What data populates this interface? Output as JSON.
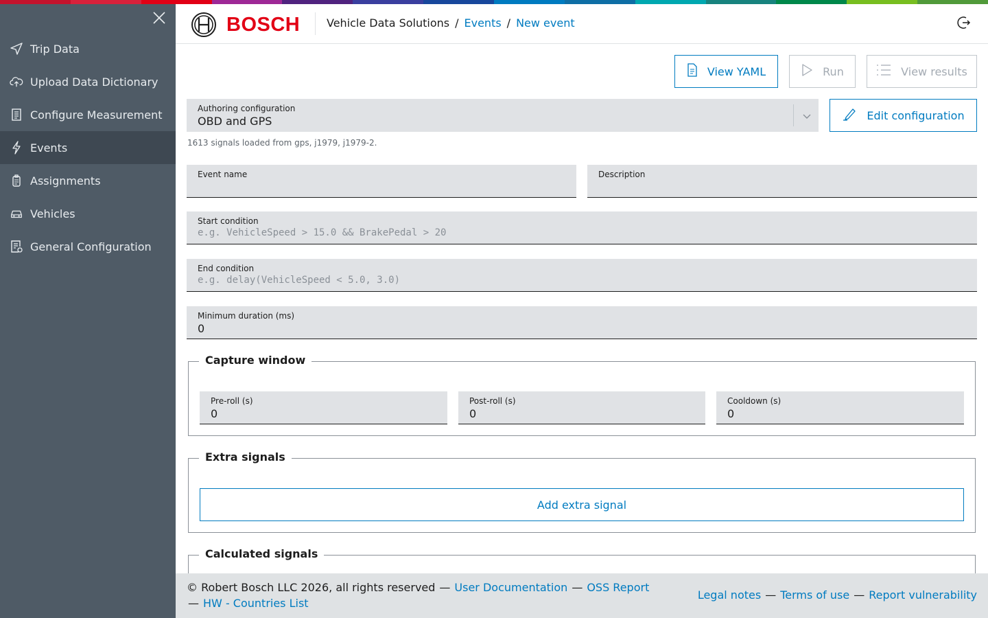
{
  "colors": {
    "brand_red": "#e20015",
    "accent_blue": "#007bc0",
    "sidebar_bg": "#4f5b66",
    "sidebar_active": "#3e4852",
    "topbar_stripes": [
      "#c3122c",
      "#d8213b",
      "#e20015",
      "#9e2896",
      "#50237f",
      "#3a3f9f",
      "#18479c",
      "#007bc0",
      "#0e6ea5",
      "#00a8b0",
      "#18837e",
      "#00884a",
      "#78be20",
      "#519a3a"
    ]
  },
  "sidebar": {
    "close_icon": "close-icon",
    "items": [
      {
        "label": "Trip Data",
        "icon": "send-icon"
      },
      {
        "label": "Upload Data Dictionary",
        "icon": "cloud-upload-icon"
      },
      {
        "label": "Configure Measurement",
        "icon": "document-list-icon"
      },
      {
        "label": "Events",
        "icon": "lightning-icon",
        "active": true
      },
      {
        "label": "Assignments",
        "icon": "assignment-icon"
      },
      {
        "label": "Vehicles",
        "icon": "car-icon"
      },
      {
        "label": "General Configuration",
        "icon": "config-document-icon"
      }
    ]
  },
  "header": {
    "brand": "BOSCH",
    "app_name": "Vehicle Data Solutions",
    "breadcrumb_sep": "/",
    "breadcrumbs": [
      "Events",
      "New event"
    ],
    "logout_icon": "logout-icon"
  },
  "toolbar": {
    "view_yaml": "View YAML",
    "run": "Run",
    "view_results": "View results"
  },
  "authoring": {
    "label": "Authoring configuration",
    "value": "OBD and GPS",
    "hint": "1613 signals loaded from gps, j1979, j1979-2.",
    "edit_button": "Edit configuration"
  },
  "form": {
    "event_name": {
      "label": "Event name",
      "value": ""
    },
    "description": {
      "label": "Description",
      "value": ""
    },
    "start_condition": {
      "label": "Start condition",
      "placeholder": "e.g. VehicleSpeed > 15.0 && BrakePedal > 20"
    },
    "end_condition": {
      "label": "End condition",
      "placeholder": "e.g. delay(VehicleSpeed < 5.0, 3.0)"
    },
    "min_duration": {
      "label": "Minimum duration (ms)",
      "value": "0"
    }
  },
  "capture_window": {
    "title": "Capture window",
    "pre_roll": {
      "label": "Pre-roll (s)",
      "value": "0"
    },
    "post_roll": {
      "label": "Post-roll (s)",
      "value": "0"
    },
    "cooldown": {
      "label": "Cooldown (s)",
      "value": "0"
    }
  },
  "extra_signals": {
    "title": "Extra signals",
    "add_button": "Add extra signal"
  },
  "calculated_signals": {
    "title": "Calculated signals"
  },
  "footer": {
    "copyright": "© Robert Bosch LLC 2026, all rights reserved",
    "dash": "—",
    "user_docs": "User Documentation",
    "oss_report": "OSS Report",
    "hw_countries": "HW - Countries List",
    "legal_notes": "Legal notes",
    "terms": "Terms of use",
    "report_vuln": "Report vulnerability"
  }
}
